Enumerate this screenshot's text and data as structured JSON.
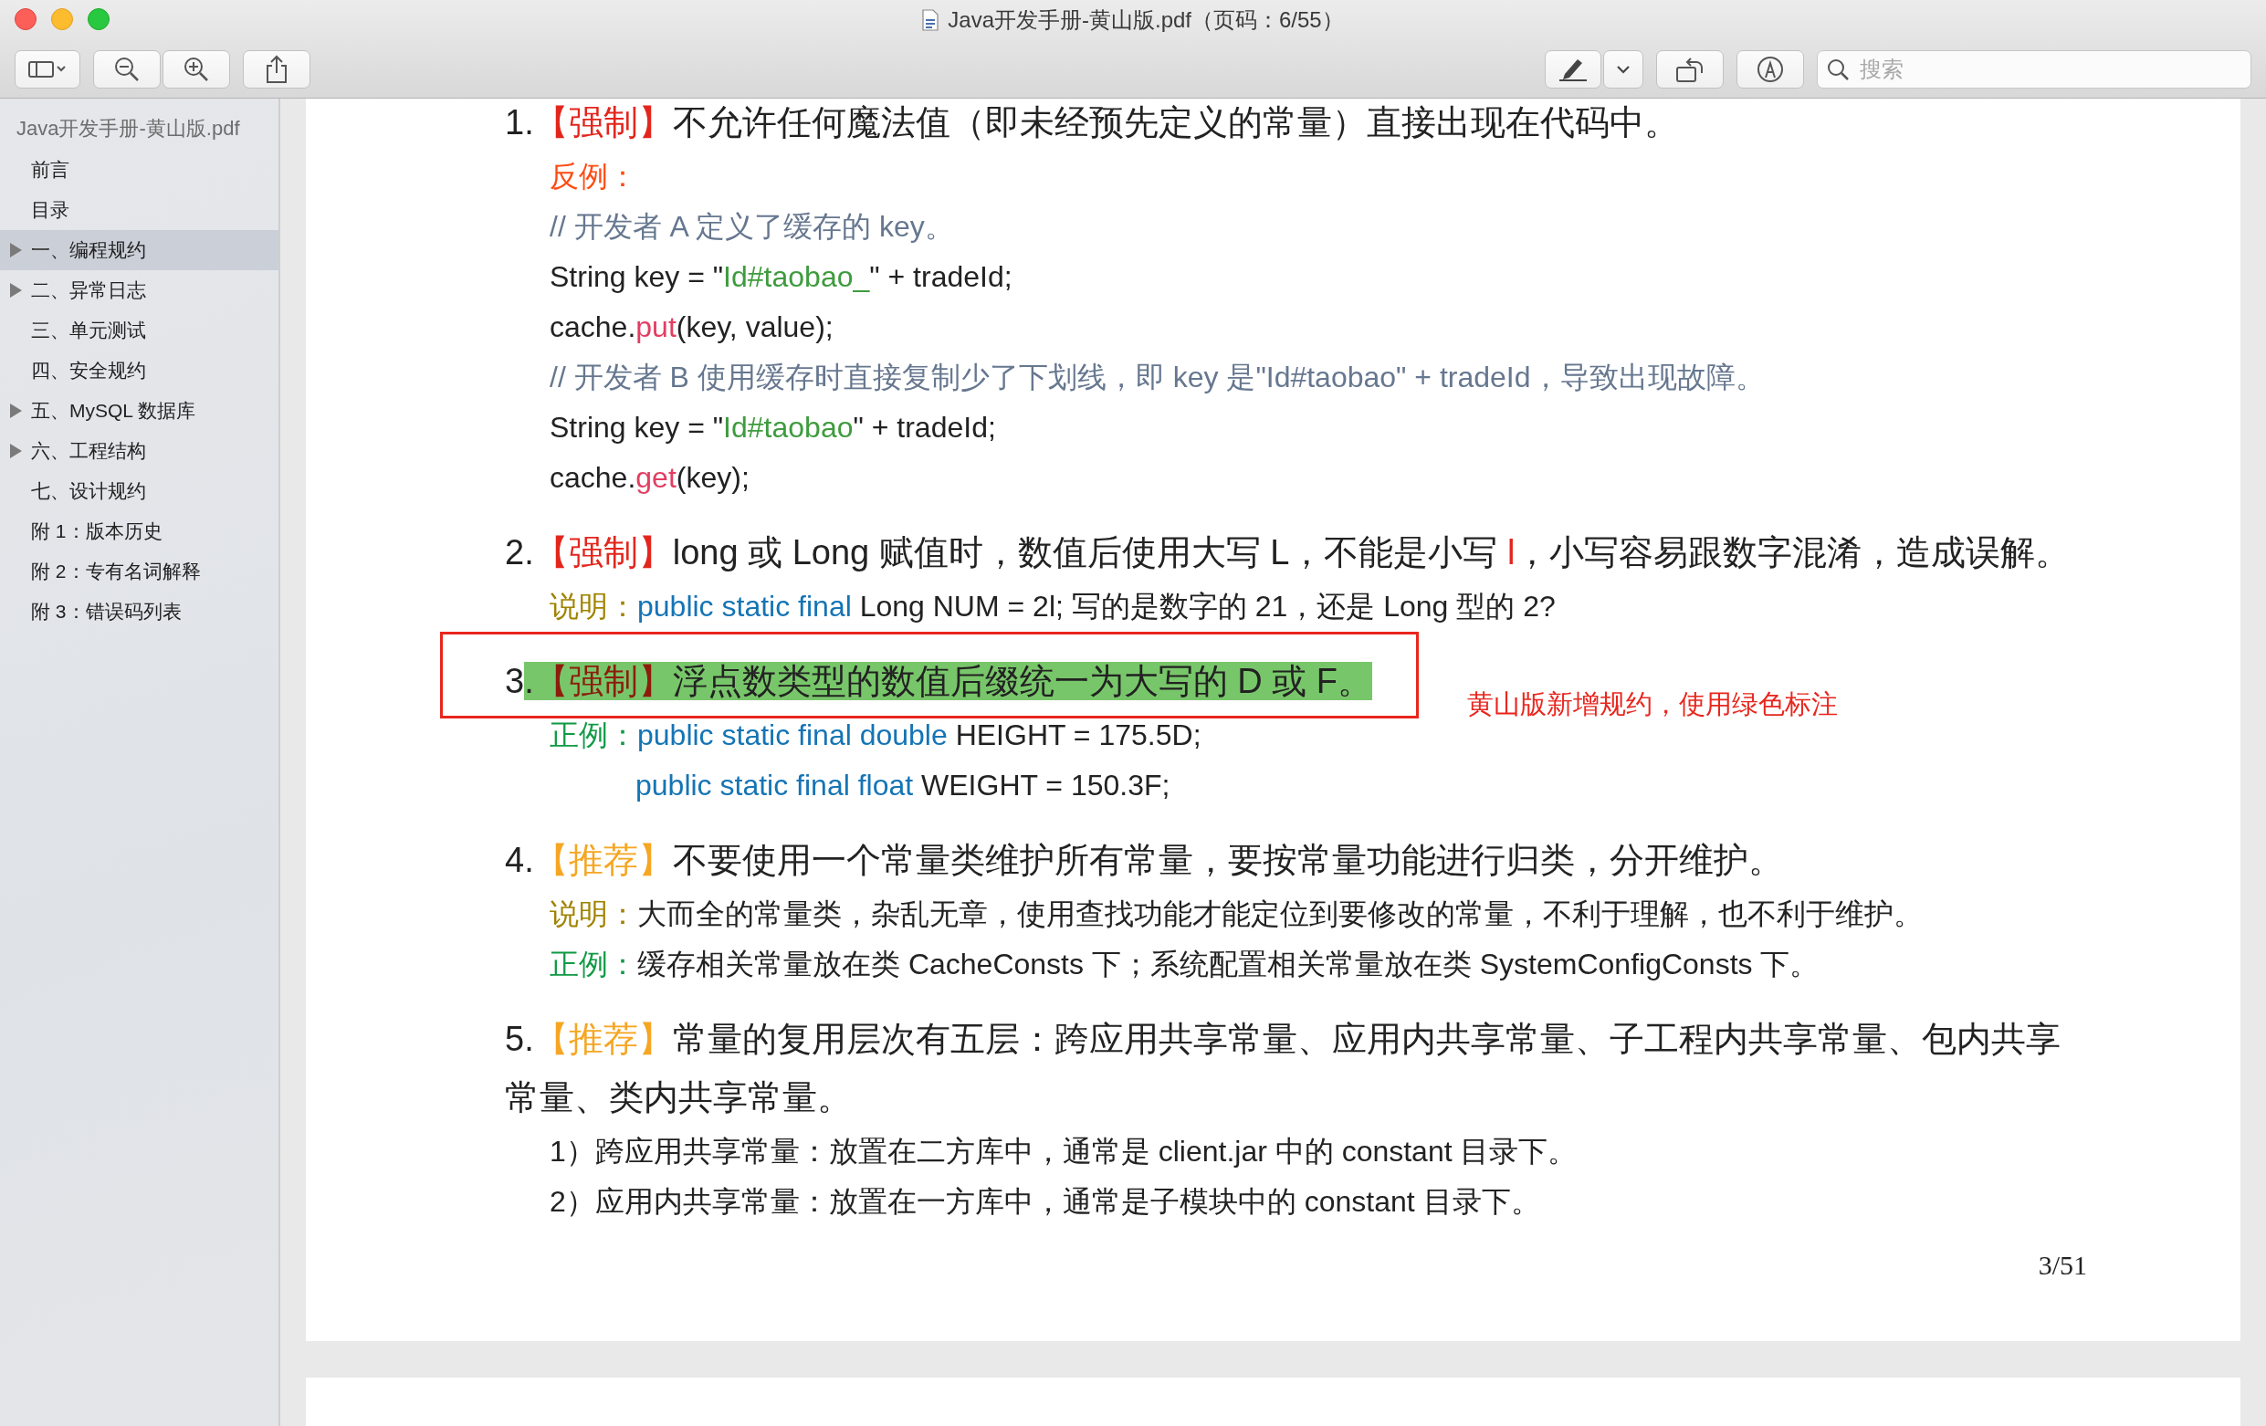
{
  "window": {
    "title": "Java开发手册-黄山版.pdf（页码：6/55）"
  },
  "toolbar": {
    "search": {
      "placeholder": "搜索"
    }
  },
  "sidebar": {
    "title": "Java开发手册-黄山版.pdf",
    "items": [
      {
        "label": "前言",
        "expandable": false,
        "selected": false
      },
      {
        "label": "目录",
        "expandable": false,
        "selected": false
      },
      {
        "label": "一、编程规约",
        "expandable": true,
        "selected": true
      },
      {
        "label": "二、异常日志",
        "expandable": true,
        "selected": false
      },
      {
        "label": "三、单元测试",
        "expandable": false,
        "selected": false
      },
      {
        "label": "四、安全规约",
        "expandable": false,
        "selected": false
      },
      {
        "label": "五、MySQL 数据库",
        "expandable": true,
        "selected": false
      },
      {
        "label": "六、工程结构",
        "expandable": true,
        "selected": false
      },
      {
        "label": "七、设计规约",
        "expandable": false,
        "selected": false
      },
      {
        "label": "附 1：版本历史",
        "expandable": false,
        "selected": false
      },
      {
        "label": "附 2：专有名词解释",
        "expandable": false,
        "selected": false
      },
      {
        "label": "附 3：错误码列表",
        "expandable": false,
        "selected": false
      }
    ]
  },
  "document": {
    "page_number": "3/51",
    "items": [
      {
        "number": "1.",
        "highlighted": false,
        "heading": [
          {
            "text": "【强制】",
            "kind": "mandatory"
          },
          {
            "text": "不允许任何魔法值（即未经预先定义的常量）直接出现在代码中。",
            "kind": "plain"
          }
        ],
        "lines": [
          {
            "kind": "normal",
            "segments": [
              {
                "text": "反例：",
                "kind": "counter-label"
              }
            ]
          },
          {
            "kind": "normal",
            "segments": [
              {
                "text": "//  开发者 A 定义了缓存的 key。",
                "kind": "comment"
              }
            ]
          },
          {
            "kind": "normal",
            "segments": [
              {
                "text": "String key = \"",
                "kind": "plain"
              },
              {
                "text": "Id#taobao_",
                "kind": "string"
              },
              {
                "text": "\" + tradeId;",
                "kind": "plain"
              }
            ]
          },
          {
            "kind": "normal",
            "segments": [
              {
                "text": "cache.",
                "kind": "plain"
              },
              {
                "text": "put",
                "kind": "method"
              },
              {
                "text": "(key, value);",
                "kind": "plain"
              }
            ]
          },
          {
            "kind": "normal",
            "segments": [
              {
                "text": "// 开发者 B 使用缓存时直接复制少了下划线，即 key 是\"Id#taobao\" + tradeId，导致出现故障。",
                "kind": "comment"
              }
            ]
          },
          {
            "kind": "normal",
            "segments": [
              {
                "text": "String key = \"",
                "kind": "plain"
              },
              {
                "text": "Id#taobao",
                "kind": "string"
              },
              {
                "text": "\" + tradeId;",
                "kind": "plain"
              }
            ]
          },
          {
            "kind": "normal",
            "segments": [
              {
                "text": "cache.",
                "kind": "plain"
              },
              {
                "text": "get",
                "kind": "method"
              },
              {
                "text": "(key);",
                "kind": "plain"
              }
            ]
          }
        ]
      },
      {
        "number": "2.",
        "highlighted": false,
        "heading": [
          {
            "text": "【强制】",
            "kind": "mandatory"
          },
          {
            "text": "long 或 Long 赋值时，数值后使用大写 L，不能是小写 ",
            "kind": "plain"
          },
          {
            "text": "l",
            "kind": "red"
          },
          {
            "text": "，小写容易跟数字混淆，造成误解。",
            "kind": "plain"
          }
        ],
        "lines": [
          {
            "kind": "normal",
            "segments": [
              {
                "text": "说明：",
                "kind": "note-label"
              },
              {
                "text": "public static final",
                "kind": "keyword"
              },
              {
                "text": " Long NUM = 2l; 写的是数字的 21，还是 Long 型的 2?",
                "kind": "plain"
              }
            ]
          }
        ]
      },
      {
        "number": "3",
        "highlighted": true,
        "annotation": "黄山版新增规约，使用绿色标注",
        "heading": [
          {
            "text": ".",
            "kind": "plain"
          },
          {
            "text": "【强制】",
            "kind": "mandatory"
          },
          {
            "text": "浮点数类型的数值后缀统一为大写的 D 或 F。",
            "kind": "plain"
          }
        ],
        "lines": [
          {
            "kind": "normal",
            "segments": [
              {
                "text": "正例：",
                "kind": "good-label"
              },
              {
                "text": "public static final double",
                "kind": "keyword"
              },
              {
                "text": " HEIGHT = 175.5D;",
                "kind": "plain"
              }
            ]
          },
          {
            "kind": "continuation",
            "segments": [
              {
                "text": "public static final float",
                "kind": "keyword"
              },
              {
                "text": " WEIGHT = 150.3F;",
                "kind": "plain"
              }
            ]
          }
        ]
      },
      {
        "number": "4.",
        "highlighted": false,
        "heading": [
          {
            "text": "【推荐】",
            "kind": "recommended"
          },
          {
            "text": "不要使用一个常量类维护所有常量，要按常量功能进行归类，分开维护。",
            "kind": "plain"
          }
        ],
        "lines": [
          {
            "kind": "normal",
            "segments": [
              {
                "text": "说明：",
                "kind": "note-label"
              },
              {
                "text": "大而全的常量类，杂乱无章，使用查找功能才能定位到要修改的常量，不利于理解，也不利于维护。",
                "kind": "plain"
              }
            ]
          },
          {
            "kind": "normal",
            "segments": [
              {
                "text": "正例：",
                "kind": "good-label"
              },
              {
                "text": "缓存相关常量放在类 CacheConsts 下；系统配置相关常量放在类 SystemConfigConsts 下。",
                "kind": "plain"
              }
            ]
          }
        ]
      },
      {
        "number": "5.",
        "highlighted": false,
        "heading": [
          {
            "text": "【推荐】",
            "kind": "recommended"
          },
          {
            "text": "常量的复用层次有五层：跨应用共享常量、应用内共享常量、子工程内共享常量、包内共享常量、类内共享常量。",
            "kind": "plain"
          }
        ],
        "lines": [
          {
            "kind": "normal",
            "segments": [
              {
                "text": "1）跨应用共享常量：放置在二方库中，通常是 client.jar 中的 constant 目录下。",
                "kind": "plain"
              }
            ]
          },
          {
            "kind": "normal",
            "segments": [
              {
                "text": "2）应用内共享常量：放置在一方库中，通常是子模块中的 constant 目录下。",
                "kind": "plain"
              }
            ]
          }
        ]
      }
    ]
  }
}
